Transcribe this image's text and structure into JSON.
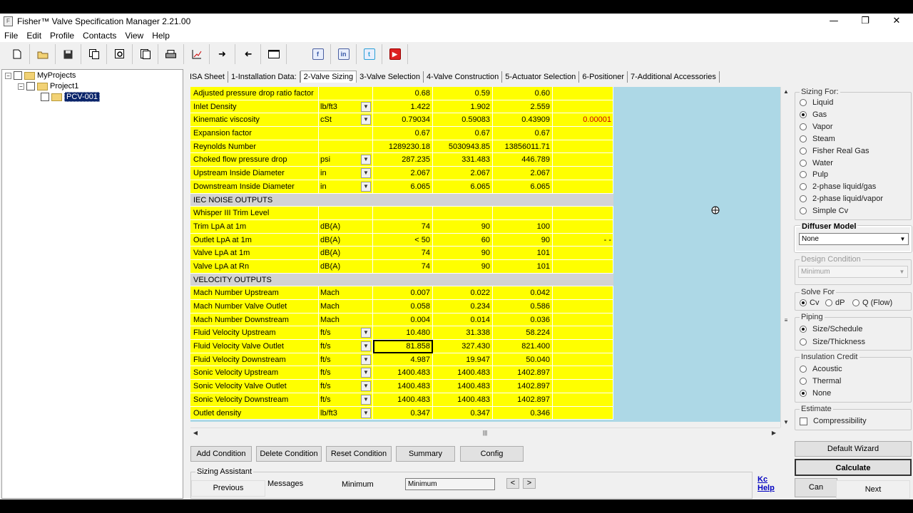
{
  "window": {
    "title": "Fisher™ Valve Specification Manager 2.21.00",
    "minimize": "—",
    "restore": "❐",
    "close": "✕"
  },
  "menu": [
    "File",
    "Edit",
    "Profile",
    "Contacts",
    "View",
    "Help"
  ],
  "toolbar_icons": [
    "new-icon",
    "open-icon",
    "save-icon",
    "copy-icon",
    "preview-icon",
    "pages-icon",
    "print-icon",
    "chart-icon",
    "forward-arrow-icon",
    "back-arrow-icon",
    "window-icon",
    "facebook-icon",
    "linkedin-icon",
    "twitter-icon",
    "youtube-icon"
  ],
  "tree": {
    "root": "MyProjects",
    "project": "Project1",
    "item": "PCV-001"
  },
  "tabs": [
    "ISA Sheet",
    "1-Installation Data:",
    "2-Valve Sizing",
    "3-Valve Selection",
    "4-Valve Construction",
    "5-Actuator Selection",
    "6-Positioner",
    "7-Additional Accessories"
  ],
  "active_tab": 2,
  "grid_rows": [
    {
      "label": "Adjusted pressure drop ratio factor",
      "unit": "",
      "dd": false,
      "v": [
        "0.68",
        "0.59",
        "0.60"
      ],
      "extra": ""
    },
    {
      "label": "Inlet Density",
      "unit": "lb/ft3",
      "dd": true,
      "v": [
        "1.422",
        "1.902",
        "2.559"
      ],
      "extra": ""
    },
    {
      "label": "Kinematic viscosity",
      "unit": "cSt",
      "dd": true,
      "v": [
        "0.79034",
        "0.59083",
        "0.43909"
      ],
      "extra": "0.00001"
    },
    {
      "label": "Expansion factor",
      "unit": "",
      "dd": false,
      "v": [
        "0.67",
        "0.67",
        "0.67"
      ],
      "extra": ""
    },
    {
      "label": "Reynolds Number",
      "unit": "",
      "dd": false,
      "v": [
        "1289230.18",
        "5030943.85",
        "13856011.71"
      ],
      "extra": ""
    },
    {
      "label": "Choked flow pressure drop",
      "unit": "psi",
      "dd": true,
      "v": [
        "287.235",
        "331.483",
        "446.789"
      ],
      "extra": ""
    },
    {
      "label": "Upstream Inside Diameter",
      "unit": "in",
      "dd": true,
      "v": [
        "2.067",
        "2.067",
        "2.067"
      ],
      "extra": ""
    },
    {
      "label": "Downstream Inside Diameter",
      "unit": "in",
      "dd": true,
      "v": [
        "6.065",
        "6.065",
        "6.065"
      ],
      "extra": ""
    },
    {
      "section": "IEC NOISE OUTPUTS"
    },
    {
      "label": "Whisper III Trim Level",
      "unit": "",
      "dd": false,
      "v": [
        "",
        "",
        ""
      ],
      "extra": ""
    },
    {
      "label": "Trim  LpA at 1m",
      "unit": "dB(A)",
      "dd": false,
      "v": [
        "74",
        "90",
        "100"
      ],
      "extra": ""
    },
    {
      "label": "Outlet LpA at 1m",
      "unit": "dB(A)",
      "dd": false,
      "v": [
        "< 50",
        "60",
        "90"
      ],
      "extra": "- -"
    },
    {
      "label": "Valve LpA at 1m",
      "unit": "dB(A)",
      "dd": false,
      "v": [
        "74",
        "90",
        "101"
      ],
      "extra": ""
    },
    {
      "label": "Valve LpA at Rn",
      "unit": "dB(A)",
      "dd": false,
      "v": [
        "74",
        "90",
        "101"
      ],
      "extra": ""
    },
    {
      "section": "VELOCITY OUTPUTS"
    },
    {
      "label": "Mach Number Upstream",
      "unit": "Mach",
      "dd": false,
      "v": [
        "0.007",
        "0.022",
        "0.042"
      ],
      "extra": ""
    },
    {
      "label": "Mach Number Valve Outlet",
      "unit": "Mach",
      "dd": false,
      "v": [
        "0.058",
        "0.234",
        "0.586"
      ],
      "extra": ""
    },
    {
      "label": "Mach Number Downstream",
      "unit": "Mach",
      "dd": false,
      "v": [
        "0.004",
        "0.014",
        "0.036"
      ],
      "extra": ""
    },
    {
      "label": "Fluid Velocity Upstream",
      "unit": "ft/s",
      "dd": true,
      "v": [
        "10.480",
        "31.338",
        "58.224"
      ],
      "extra": ""
    },
    {
      "label": "Fluid Velocity Valve Outlet",
      "unit": "ft/s",
      "dd": true,
      "v": [
        "81.858",
        "327.430",
        "821.400"
      ],
      "extra": "",
      "selected": true
    },
    {
      "label": "Fluid Velocity Downstream",
      "unit": "ft/s",
      "dd": true,
      "v": [
        "4.987",
        "19.947",
        "50.040"
      ],
      "extra": ""
    },
    {
      "label": "Sonic Velocity Upstream",
      "unit": "ft/s",
      "dd": true,
      "v": [
        "1400.483",
        "1400.483",
        "1402.897"
      ],
      "extra": ""
    },
    {
      "label": "Sonic Velocity Valve Outlet",
      "unit": "ft/s",
      "dd": true,
      "v": [
        "1400.483",
        "1400.483",
        "1402.897"
      ],
      "extra": ""
    },
    {
      "label": "Sonic Velocity Downstream",
      "unit": "ft/s",
      "dd": true,
      "v": [
        "1400.483",
        "1400.483",
        "1402.897"
      ],
      "extra": ""
    },
    {
      "label": "Outlet density",
      "unit": "lb/ft3",
      "dd": true,
      "v": [
        "0.347",
        "0.347",
        "0.346"
      ],
      "extra": ""
    }
  ],
  "buttons": {
    "add": "Add Condition",
    "delete": "Delete Condition",
    "reset": "Reset Condition",
    "summary": "Summary",
    "config": "Config",
    "previous": "Previous",
    "next": "Next",
    "default_wizard": "Default Wizard",
    "calculate": "Calculate",
    "cancel": "Can"
  },
  "sizing_assistant": {
    "title": "Sizing Assistant",
    "messages": "Messages",
    "minimum_label": "Minimum",
    "minimum_value": "Minimum",
    "prev": "<",
    "next": ">",
    "kc_help": "Kc Help"
  },
  "sizing_for": {
    "title": "Sizing For:",
    "options": [
      "Liquid",
      "Gas",
      "Vapor",
      "Steam",
      "Fisher Real Gas",
      "Water",
      "Pulp",
      "2-phase liquid/gas",
      "2-phase liquid/vapor",
      "Simple Cv"
    ],
    "selected": 1
  },
  "diffuser": {
    "title": "Diffuser Model",
    "value": "None"
  },
  "design_condition": {
    "title": "Design Condition",
    "value": "Minimum"
  },
  "solve_for": {
    "title": "Solve For",
    "options": [
      "Cv",
      "dP",
      "Q (Flow)"
    ],
    "selected": 0
  },
  "piping": {
    "title": "Piping",
    "options": [
      "Size/Schedule",
      "Size/Thickness"
    ],
    "selected": 0
  },
  "insulation": {
    "title": "Insulation Credit",
    "options": [
      "Acoustic",
      "Thermal",
      "None"
    ],
    "selected": 2
  },
  "estimate": {
    "title": "Estimate",
    "option": "Compressibility"
  }
}
